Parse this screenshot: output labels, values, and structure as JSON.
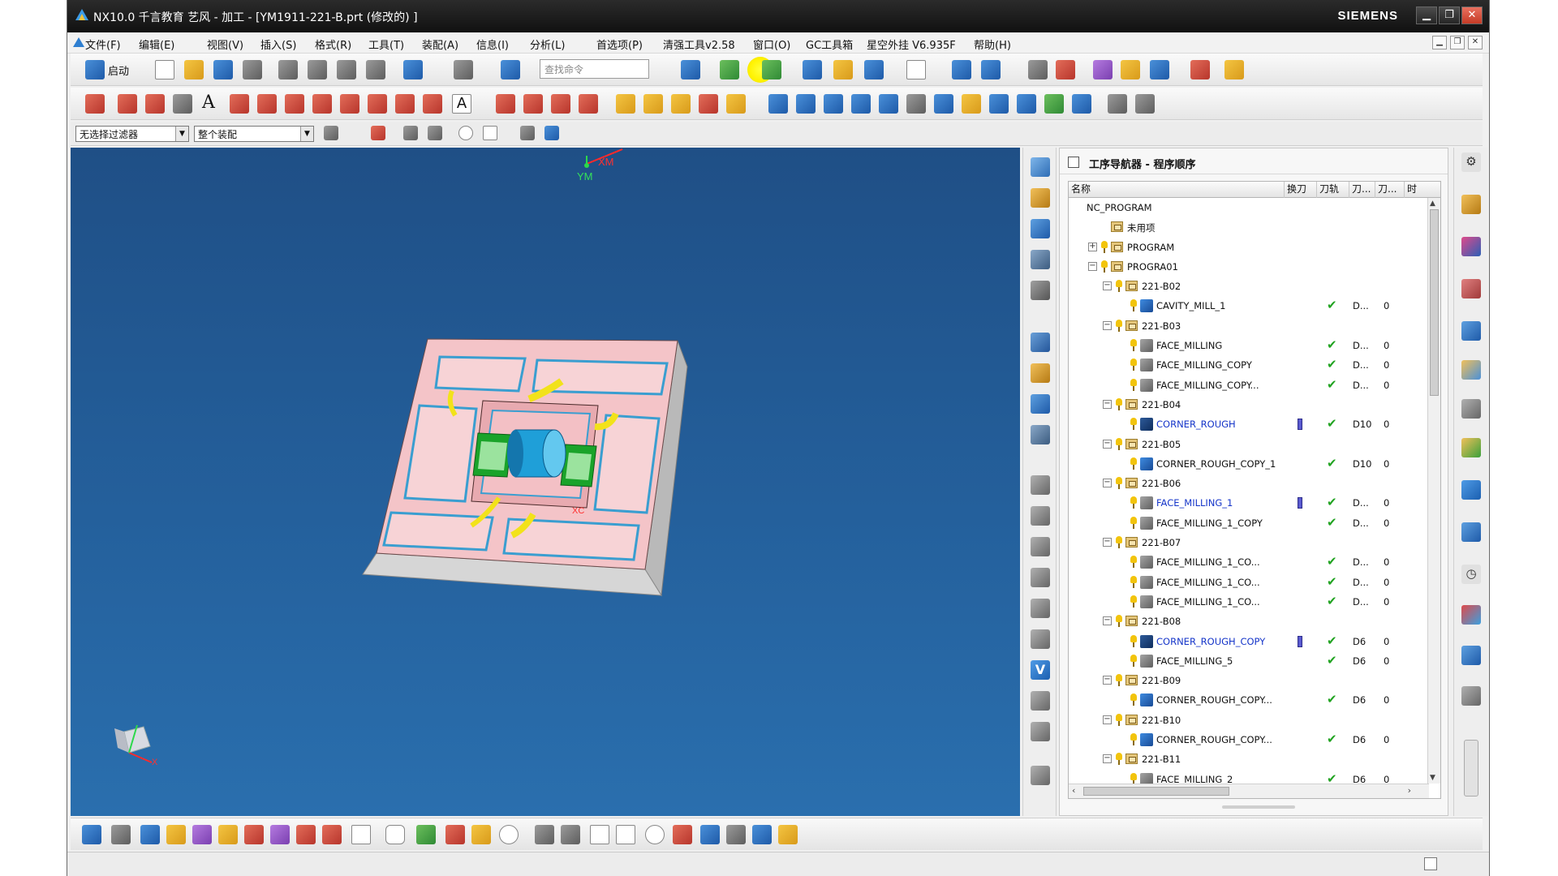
{
  "window": {
    "title": "NX10.0 千言教育 艺风 - 加工 - [YM1911-221-B.prt  (修改的) ]",
    "brand": "SIEMENS",
    "minimize": "▁",
    "maximize": "❐",
    "close": "✕"
  },
  "menu": {
    "items": [
      "文件(F)",
      "编辑(E)",
      "视图(V)",
      "插入(S)",
      "格式(R)",
      "工具(T)",
      "装配(A)",
      "信息(I)",
      "分析(L)",
      "首选项(P)",
      "清强工具v2.58",
      "窗口(O)",
      "GC工具箱",
      "星空外挂 V6.935F",
      "帮助(H)"
    ]
  },
  "toolbar": {
    "start_label": "启动",
    "search_placeholder": "查找命令",
    "text_tool": "A"
  },
  "filters": {
    "selection_filter": "无选择过滤器",
    "assembly_scope": "整个装配"
  },
  "viewport": {
    "axis_ym": "YM",
    "axis_xm": "XM",
    "axis_xc": "XC",
    "triad_x": "X"
  },
  "navigator": {
    "title": "工序导航器 - 程序顺序",
    "columns": [
      "名称",
      "换刀",
      "刀轨",
      "刀...",
      "刀...",
      "时"
    ],
    "rows": [
      {
        "level": 0,
        "kind": "root",
        "expand": "",
        "name": "NC_PROGRAM",
        "toolchange": false,
        "path": false,
        "tool": "",
        "num": ""
      },
      {
        "level": 1,
        "kind": "folder",
        "expand": "",
        "name": "未用项",
        "toolchange": false,
        "path": false,
        "tool": "",
        "num": ""
      },
      {
        "level": 1,
        "kind": "group",
        "expand": "+",
        "name": "PROGRAM",
        "toolchange": false,
        "path": false,
        "tool": "",
        "num": ""
      },
      {
        "level": 1,
        "kind": "group",
        "expand": "−",
        "name": "PROGRA01",
        "toolchange": false,
        "path": false,
        "tool": "",
        "num": ""
      },
      {
        "level": 2,
        "kind": "group",
        "expand": "−",
        "name": "221-B02",
        "toolchange": false,
        "path": false,
        "tool": "",
        "num": ""
      },
      {
        "level": 3,
        "kind": "op",
        "expand": "",
        "name": "CAVITY_MILL_1",
        "toolchange": false,
        "path": true,
        "tool": "D...",
        "num": "0"
      },
      {
        "level": 2,
        "kind": "group",
        "expand": "−",
        "name": "221-B03",
        "toolchange": false,
        "path": false,
        "tool": "",
        "num": ""
      },
      {
        "level": 3,
        "kind": "opgrey",
        "expand": "",
        "name": "FACE_MILLING",
        "toolchange": false,
        "path": true,
        "tool": "D...",
        "num": "0"
      },
      {
        "level": 3,
        "kind": "opgrey",
        "expand": "",
        "name": "FACE_MILLING_COPY",
        "toolchange": false,
        "path": true,
        "tool": "D...",
        "num": "0"
      },
      {
        "level": 3,
        "kind": "opgrey",
        "expand": "",
        "name": "FACE_MILLING_COPY...",
        "toolchange": false,
        "path": true,
        "tool": "D...",
        "num": "0"
      },
      {
        "level": 2,
        "kind": "group",
        "expand": "−",
        "name": "221-B04",
        "toolchange": false,
        "path": false,
        "tool": "",
        "num": ""
      },
      {
        "level": 3,
        "kind": "opblue",
        "expand": "",
        "name": "CORNER_ROUGH",
        "toolchange": true,
        "path": true,
        "tool": "D10",
        "num": "0"
      },
      {
        "level": 2,
        "kind": "group",
        "expand": "−",
        "name": "221-B05",
        "toolchange": false,
        "path": false,
        "tool": "",
        "num": ""
      },
      {
        "level": 3,
        "kind": "op",
        "expand": "",
        "name": "CORNER_ROUGH_COPY_1",
        "toolchange": false,
        "path": true,
        "tool": "D10",
        "num": "0"
      },
      {
        "level": 2,
        "kind": "group",
        "expand": "−",
        "name": "221-B06",
        "toolchange": false,
        "path": false,
        "tool": "",
        "num": ""
      },
      {
        "level": 3,
        "kind": "opgreyblue",
        "expand": "",
        "name": "FACE_MILLING_1",
        "toolchange": true,
        "path": true,
        "tool": "D...",
        "num": "0"
      },
      {
        "level": 3,
        "kind": "opgrey",
        "expand": "",
        "name": "FACE_MILLING_1_COPY",
        "toolchange": false,
        "path": true,
        "tool": "D...",
        "num": "0"
      },
      {
        "level": 2,
        "kind": "group",
        "expand": "−",
        "name": "221-B07",
        "toolchange": false,
        "path": false,
        "tool": "",
        "num": ""
      },
      {
        "level": 3,
        "kind": "opgrey",
        "expand": "",
        "name": "FACE_MILLING_1_CO...",
        "toolchange": false,
        "path": true,
        "tool": "D...",
        "num": "0"
      },
      {
        "level": 3,
        "kind": "opgrey",
        "expand": "",
        "name": "FACE_MILLING_1_CO...",
        "toolchange": false,
        "path": true,
        "tool": "D...",
        "num": "0"
      },
      {
        "level": 3,
        "kind": "opgrey",
        "expand": "",
        "name": "FACE_MILLING_1_CO...",
        "toolchange": false,
        "path": true,
        "tool": "D...",
        "num": "0"
      },
      {
        "level": 2,
        "kind": "group",
        "expand": "−",
        "name": "221-B08",
        "toolchange": false,
        "path": false,
        "tool": "",
        "num": ""
      },
      {
        "level": 3,
        "kind": "opblue",
        "expand": "",
        "name": "CORNER_ROUGH_COPY",
        "toolchange": true,
        "path": true,
        "tool": "D6",
        "num": "0"
      },
      {
        "level": 3,
        "kind": "opgrey",
        "expand": "",
        "name": "FACE_MILLING_5",
        "toolchange": false,
        "path": true,
        "tool": "D6",
        "num": "0"
      },
      {
        "level": 2,
        "kind": "group",
        "expand": "−",
        "name": "221-B09",
        "toolchange": false,
        "path": false,
        "tool": "",
        "num": ""
      },
      {
        "level": 3,
        "kind": "op",
        "expand": "",
        "name": "CORNER_ROUGH_COPY...",
        "toolchange": false,
        "path": true,
        "tool": "D6",
        "num": "0"
      },
      {
        "level": 2,
        "kind": "group",
        "expand": "−",
        "name": "221-B10",
        "toolchange": false,
        "path": false,
        "tool": "",
        "num": ""
      },
      {
        "level": 3,
        "kind": "op",
        "expand": "",
        "name": "CORNER_ROUGH_COPY...",
        "toolchange": false,
        "path": true,
        "tool": "D6",
        "num": "0"
      },
      {
        "level": 2,
        "kind": "group",
        "expand": "−",
        "name": "221-B11",
        "toolchange": false,
        "path": false,
        "tool": "",
        "num": ""
      },
      {
        "level": 3,
        "kind": "opgrey",
        "expand": "",
        "name": "FACE_MILLING_2",
        "toolchange": false,
        "path": true,
        "tool": "D6",
        "num": "0"
      }
    ],
    "check_glyph": "✔",
    "scroll_up": "▲",
    "scroll_down": "▼",
    "scroll_left": "‹",
    "scroll_right": "›"
  },
  "colors": {
    "viewport_top": "#1f4f86",
    "viewport_bottom": "#2a6fae",
    "part_face": "#f4c4c8",
    "part_side": "#d8d8d8",
    "check": "#21a321",
    "link_blue": "#1535c9"
  }
}
